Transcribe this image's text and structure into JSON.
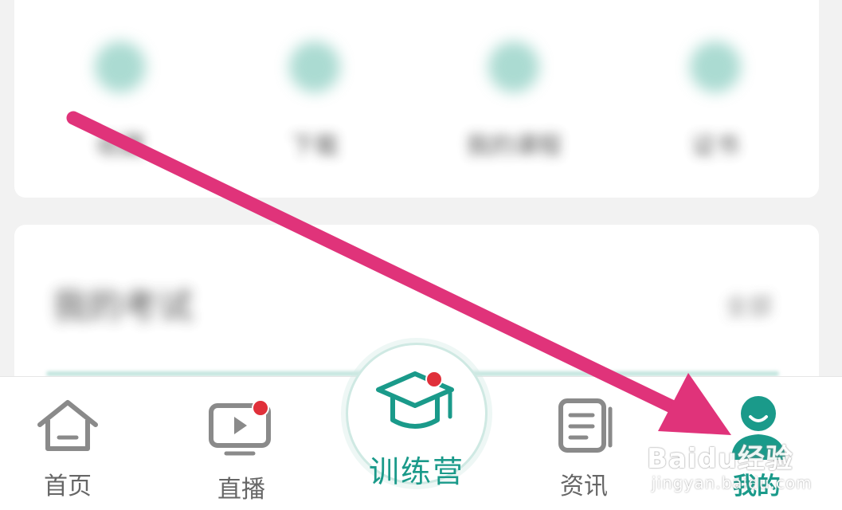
{
  "blurred_grid": {
    "items": [
      {
        "label": "收藏"
      },
      {
        "label": "下载"
      },
      {
        "label": "我的课程"
      },
      {
        "label": "证书"
      }
    ]
  },
  "section": {
    "title": "我的考试",
    "more": "全部"
  },
  "bottom_nav": {
    "items": [
      {
        "label": "首页",
        "icon": "home-icon"
      },
      {
        "label": "直播",
        "icon": "tv-play-icon",
        "badge": true
      },
      {
        "label": "训练营",
        "icon": "graduation-cap-icon",
        "badge": true,
        "active": true
      },
      {
        "label": "资讯",
        "icon": "news-document-icon"
      },
      {
        "label": "我的",
        "icon": "user-profile-icon",
        "selected": true
      }
    ]
  },
  "watermark": {
    "text": "Baidu经验",
    "sub": "jingyan.baidu.com"
  },
  "colors": {
    "accent": "#1a9a8a",
    "arrow": "#e0337a",
    "badge": "#e0303a",
    "inactive": "#888888"
  }
}
